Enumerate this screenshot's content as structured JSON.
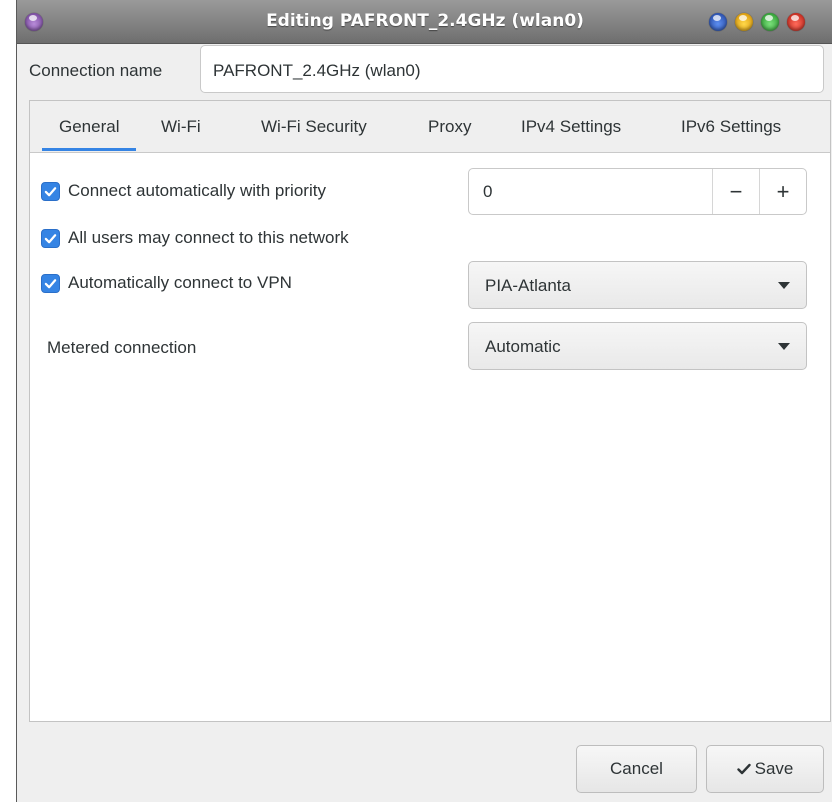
{
  "window": {
    "title": "Editing PAFRONT_2.4GHz (wlan0)"
  },
  "connection": {
    "label": "Connection name",
    "value": "PAFRONT_2.4GHz (wlan0)"
  },
  "tabs": [
    {
      "label": "General",
      "active": true
    },
    {
      "label": "Wi-Fi"
    },
    {
      "label": "Wi-Fi Security"
    },
    {
      "label": "Proxy"
    },
    {
      "label": "IPv4 Settings"
    },
    {
      "label": "IPv6 Settings"
    }
  ],
  "general": {
    "auto_connect": {
      "label": "Connect automatically with priority",
      "checked": true
    },
    "priority": {
      "value": "0",
      "minus": "−",
      "plus": "+"
    },
    "all_users": {
      "label": "All users may connect to this network",
      "checked": true
    },
    "auto_vpn": {
      "label": "Automatically connect to VPN",
      "checked": true
    },
    "vpn_select": {
      "value": "PIA-Atlanta"
    },
    "metered": {
      "label": "Metered connection",
      "value": "Automatic"
    }
  },
  "buttons": {
    "cancel": "Cancel",
    "save": "Save"
  },
  "colors": {
    "accent": "#3584e4"
  }
}
